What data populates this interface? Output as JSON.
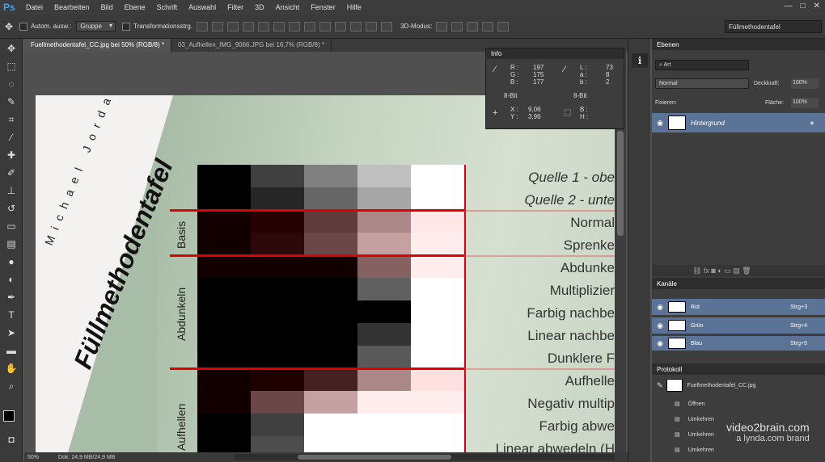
{
  "menubar": {
    "logo": "Ps",
    "items": [
      "Datei",
      "Bearbeiten",
      "Bild",
      "Ebene",
      "Schrift",
      "Auswahl",
      "Filter",
      "3D",
      "Ansicht",
      "Fenster",
      "Hilfe"
    ],
    "window_min": "—",
    "window_max": "□",
    "window_close": "✕"
  },
  "options": {
    "auto_select_label": "Autom. ausw.:",
    "auto_select_value": "Gruppe",
    "transform_label": "Transformationsstrg.",
    "mode3d_label": "3D-Modus:",
    "workspace": "Füllmethodentafel"
  },
  "tabs": [
    {
      "label": "Fuellmethodentafel_CC.jpg bei 50% (RGB/8) *"
    },
    {
      "label": "03_Aufhellen_IMG_9066.JPG bei 16,7% (RGB/8) *"
    }
  ],
  "document": {
    "author": "Michael Jordans",
    "title": "Füllmethodentafel",
    "groups": {
      "basis": "Basis",
      "abdunkeln": "Abdunkeln",
      "aufhellen": "Aufhellen"
    },
    "labels": [
      "Quelle 1 - obe",
      "Quelle 2 - unte",
      "Normal",
      "Sprenke",
      "Abdunke",
      "Multiplizier",
      "Farbig nachbe",
      "Linear nachbe",
      "Dunklere F",
      "Aufhelle",
      "Negativ multip",
      "Farbig abwe",
      "Linear abwedeln (H"
    ]
  },
  "info_panel": {
    "title": "Info",
    "r": "197",
    "g": "175",
    "b": "177",
    "l": "73",
    "a": "8",
    "b2": "2",
    "bit1": "8-Bit",
    "bit2": "8-Bit",
    "x": "9,06",
    "y": "3,96",
    "w": "",
    "h": ""
  },
  "status": {
    "zoom": "50%",
    "doc": "Dok: 24,9 MB/24,9 MB"
  },
  "layers": {
    "title": "Ebenen",
    "filter": "Art",
    "blend": "Normal",
    "opacity_label": "Deckkraft:",
    "opacity": "100%",
    "lock_label": "Fixieren:",
    "fill_label": "Fläche:",
    "fill": "100%",
    "layer_name": "Hintergrund"
  },
  "channels": {
    "title": "Kanäle",
    "items": [
      {
        "name": "Rot",
        "key": "Strg+3"
      },
      {
        "name": "Grün",
        "key": "Strg+4"
      },
      {
        "name": "Blau",
        "key": "Strg+5"
      }
    ]
  },
  "history": {
    "title": "Protokoll",
    "snapshot": "Fuellmethodentafel_CC.jpg",
    "items": [
      "Öffnen",
      "Umkehren",
      "Umkehren",
      "Umkehren"
    ]
  },
  "watermark": {
    "brand": "video2brain.com",
    "sub": "a lynda.com brand"
  },
  "colors": {
    "accent_red": "#e00000",
    "layer_selected": "#5b7396"
  }
}
